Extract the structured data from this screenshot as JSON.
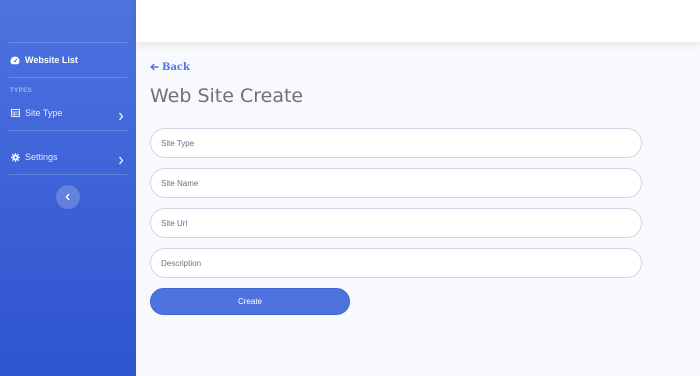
{
  "sidebar": {
    "top_item": {
      "label": "Website List",
      "icon": "tachometer-icon"
    },
    "heading": "TYPES",
    "items": [
      {
        "label": "Site Type",
        "icon": "table-icon"
      },
      {
        "label": "Settings",
        "icon": "cog-icon"
      }
    ],
    "toggle_icon": "chevron-left-icon"
  },
  "main": {
    "back_label": "Back",
    "title": "Web Site Create",
    "form": {
      "site_type_placeholder": "Site Type",
      "site_name_placeholder": "Site Name",
      "site_url_placeholder": "Site Url",
      "description_placeholder": "Description",
      "submit_label": "Create"
    }
  },
  "colors": {
    "primary": "#4e73df",
    "background": "#f8f9fc",
    "title_gray": "#6e707e"
  }
}
